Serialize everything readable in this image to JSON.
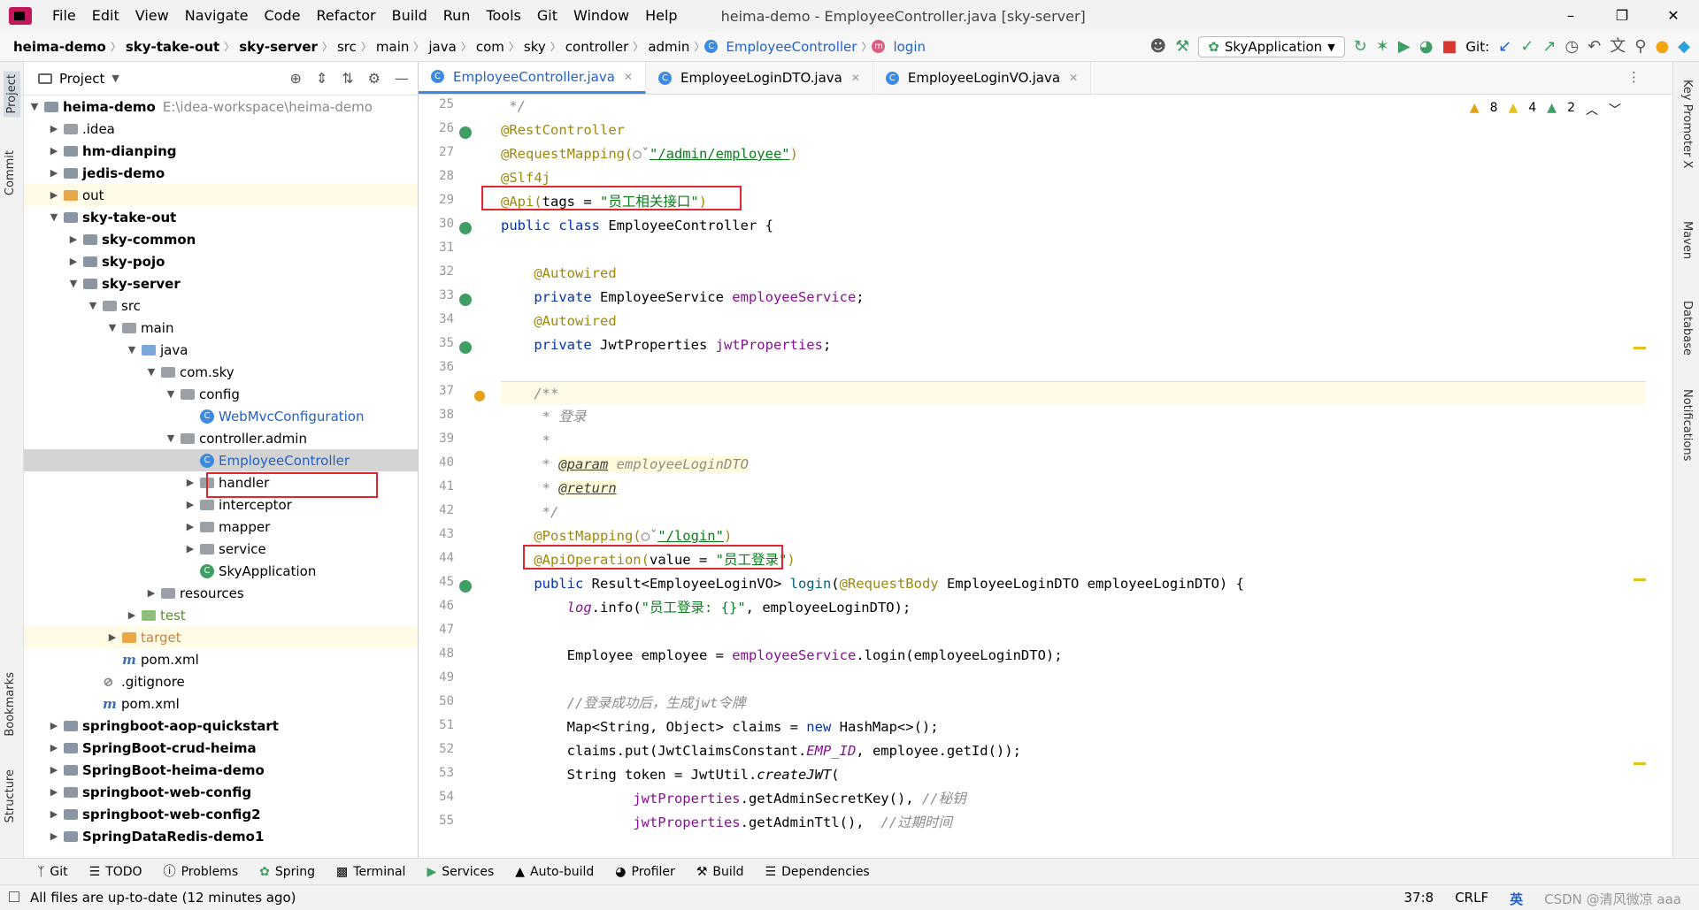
{
  "window": {
    "title": "heima-demo - EmployeeController.java [sky-server]",
    "menu": [
      "File",
      "Edit",
      "View",
      "Navigate",
      "Code",
      "Refactor",
      "Build",
      "Run",
      "Tools",
      "Git",
      "Window",
      "Help"
    ],
    "minimize": "–",
    "maximize": "❐",
    "close": "✕"
  },
  "breadcrumbs": [
    "heima-demo",
    "sky-take-out",
    "sky-server",
    "src",
    "main",
    "java",
    "com",
    "sky",
    "controller",
    "admin",
    "EmployeeController",
    "login"
  ],
  "toolbar": {
    "run_config": "SkyApplication",
    "git_label": "Git:"
  },
  "project_panel": {
    "title": "Project",
    "tree": [
      {
        "label": "heima-demo",
        "path": "E:\\idea-workspace\\heima-demo",
        "bold": true
      },
      {
        "label": ".idea"
      },
      {
        "label": "hm-dianping",
        "bold": true
      },
      {
        "label": "jedis-demo",
        "bold": true
      },
      {
        "label": "out"
      },
      {
        "label": "sky-take-out",
        "bold": true
      },
      {
        "label": "sky-common",
        "bold": true
      },
      {
        "label": "sky-pojo",
        "bold": true
      },
      {
        "label": "sky-server",
        "bold": true
      },
      {
        "label": "src"
      },
      {
        "label": "main"
      },
      {
        "label": "java"
      },
      {
        "label": "com.sky"
      },
      {
        "label": "config"
      },
      {
        "label": "WebMvcConfiguration"
      },
      {
        "label": "controller.admin"
      },
      {
        "label": "EmployeeController"
      },
      {
        "label": "handler"
      },
      {
        "label": "interceptor"
      },
      {
        "label": "mapper"
      },
      {
        "label": "service"
      },
      {
        "label": "SkyApplication"
      },
      {
        "label": "resources"
      },
      {
        "label": "test"
      },
      {
        "label": "target"
      },
      {
        "label": "pom.xml"
      },
      {
        "label": ".gitignore"
      },
      {
        "label": "pom.xml"
      },
      {
        "label": "springboot-aop-quickstart",
        "bold": true
      },
      {
        "label": "SpringBoot-crud-heima",
        "bold": true
      },
      {
        "label": "SpringBoot-heima-demo",
        "bold": true
      },
      {
        "label": "springboot-web-config",
        "bold": true
      },
      {
        "label": "springboot-web-config2",
        "bold": true
      },
      {
        "label": "SpringDataRedis-demo1",
        "bold": true
      }
    ]
  },
  "left_tool_tabs": [
    "Project",
    "Commit",
    "Bookmarks",
    "Structure"
  ],
  "right_tool_tabs": [
    "Key Promoter X",
    "Maven",
    "Database",
    "Notifications"
  ],
  "editor": {
    "tabs": [
      "EmployeeController.java",
      "EmployeeLoginDTO.java",
      "EmployeeLoginVO.java"
    ],
    "inspections": {
      "warnings": "8",
      "weak_warnings": "4",
      "typos": "2"
    },
    "line_numbers": [
      "25",
      "26",
      "27",
      "28",
      "29",
      "30",
      "31",
      "32",
      "33",
      "34",
      "35",
      "36",
      "37",
      "38",
      "39",
      "40",
      "41",
      "42",
      "43",
      "44",
      "45",
      "46",
      "47",
      "48",
      "49",
      "50",
      "51",
      "52",
      "53",
      "54",
      "55"
    ],
    "code": {
      "l25": " */",
      "l26": "@RestController",
      "l27a": "@RequestMapping(",
      "l27b": "\"/admin/employee\"",
      "l27c": ")",
      "l28": "@Slf4j",
      "l29a": "@Api(",
      "l29b": "tags = ",
      "l29c": "\"员工相关接口\"",
      "l29d": ")",
      "l30a": "public class ",
      "l30b": "EmployeeController {",
      "l32": "    @Autowired",
      "l33a": "    private ",
      "l33b": "EmployeeService ",
      "l33c": "employeeService",
      "l33d": ";",
      "l34": "    @Autowired",
      "l35a": "    private ",
      "l35b": "JwtProperties ",
      "l35c": "jwtProperties",
      "l35d": ";",
      "l37": "    /**",
      "l38": "     * 登录",
      "l39": "     *",
      "l40a": "     * ",
      "l40b": "@param",
      "l40c": " employeeLoginDTO",
      "l41a": "     * ",
      "l41b": "@return",
      "l42": "     */",
      "l43a": "    @PostMapping(",
      "l43b": "\"/login\"",
      "l43c": ")",
      "l44a": "    @ApiOperation(",
      "l44b": "value = ",
      "l44c": "\"员工登录\"",
      "l44d": ")",
      "l45a": "    public ",
      "l45b": "Result<EmployeeLoginVO> ",
      "l45c": "login",
      "l45d": "(",
      "l45e": "@RequestBody ",
      "l45f": "EmployeeLoginDTO employeeLoginDTO) {",
      "l46a": "        log",
      "l46b": ".info(",
      "l46c": "\"员工登录: {}\"",
      "l46d": ", employeeLoginDTO);",
      "l48a": "        Employee employee = ",
      "l48b": "employeeService",
      "l48c": ".login(employeeLoginDTO);",
      "l50": "        //登录成功后，生成jwt令牌",
      "l51a": "        Map<String, Object> claims = ",
      "l51b": "new ",
      "l51c": "HashMap<>();",
      "l52a": "        claims.put(JwtClaimsConstant.",
      "l52b": "EMP_ID",
      "l52c": ", employee.getId());",
      "l53a": "        String token = JwtUtil.",
      "l53b": "createJWT",
      "l53c": "(",
      "l54a": "                ",
      "l54b": "jwtProperties",
      "l54c": ".getAdminSecretKey(), ",
      "l54d": "//秘钥",
      "l55a": "                ",
      "l55b": "jwtProperties",
      "l55c": ".getAdminTtl(),  ",
      "l55d": "//过期时间"
    }
  },
  "tool_windows": [
    "Git",
    "TODO",
    "Problems",
    "Spring",
    "Terminal",
    "Services",
    "Auto-build",
    "Profiler",
    "Build",
    "Dependencies"
  ],
  "status": {
    "message": "All files are up-to-date (12 minutes ago)",
    "position": "37:8",
    "line_ending": "CRLF",
    "ime": "英",
    "watermark": "CSDN @清风微凉 aaa"
  },
  "colors": {
    "highlight_box": "#e0262f",
    "accent": "#3d8be0"
  }
}
